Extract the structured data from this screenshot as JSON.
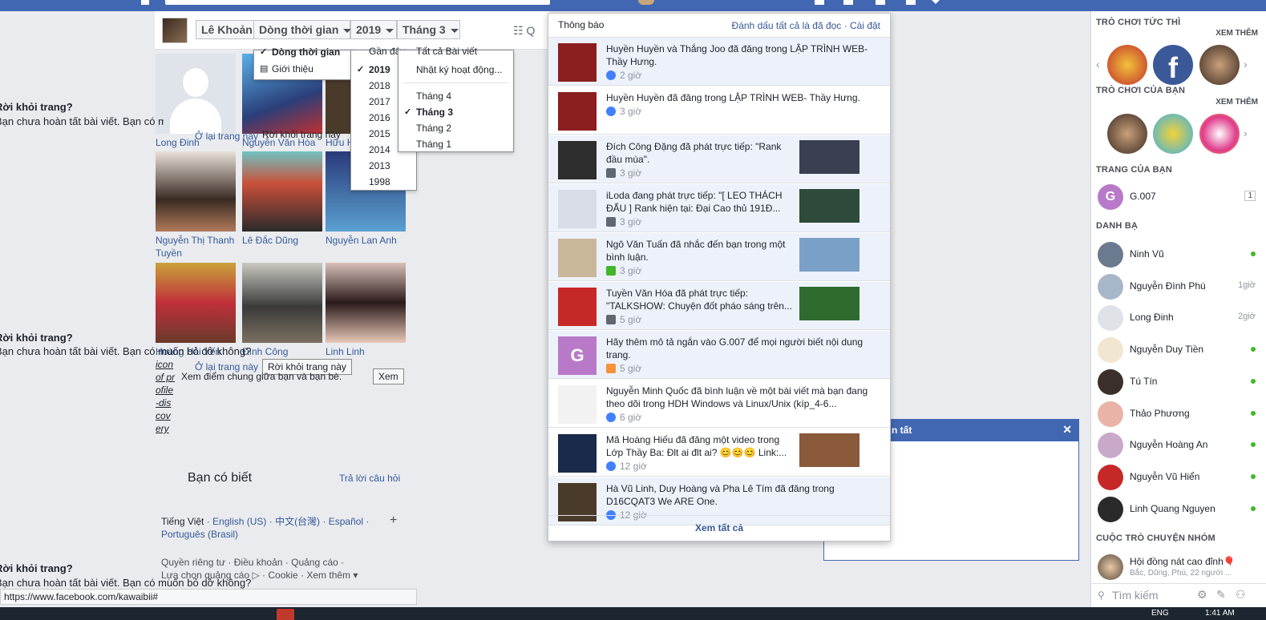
{
  "timeline_bar": {
    "name_button": "Lê Khoản",
    "view_select": "Dòng thời gian",
    "year_select": "2019",
    "month_select": "Tháng 3",
    "settings_label": "Q"
  },
  "view_menu": {
    "items": [
      {
        "label": "Dòng thời gian",
        "checked": true
      },
      {
        "label": "Giới thiệu",
        "checked": false
      }
    ]
  },
  "year_menu": {
    "header": "Gần đây",
    "items": [
      {
        "label": "2019",
        "checked": true
      },
      {
        "label": "2018",
        "checked": false
      },
      {
        "label": "2017",
        "checked": false
      },
      {
        "label": "2016",
        "checked": false
      },
      {
        "label": "2015",
        "checked": false
      },
      {
        "label": "2014",
        "checked": false
      },
      {
        "label": "2013",
        "checked": false
      },
      {
        "label": "1998",
        "checked": false
      }
    ]
  },
  "month_menu": {
    "top_items": [
      "Tất cả Bài viết",
      "Nhật ký hoạt động..."
    ],
    "items": [
      {
        "label": "Tháng 4",
        "checked": false
      },
      {
        "label": "Tháng 3",
        "checked": true
      },
      {
        "label": "Tháng 2",
        "checked": false
      },
      {
        "label": "Tháng 1",
        "checked": false
      }
    ]
  },
  "friends": [
    {
      "name": "Long Đinh"
    },
    {
      "name": "Nguyễn Văn Hòa"
    },
    {
      "name": "Hữu H"
    },
    {
      "name": "Nguyễn Thị Thanh Tuyền"
    },
    {
      "name": "Lê Đắc Dũng"
    },
    {
      "name": "Nguyễn Lan Anh"
    },
    {
      "name": "Hoàng Hải Yến"
    },
    {
      "name": "Đình Công"
    },
    {
      "name": "Linh Linh"
    }
  ],
  "leave_dialogs": {
    "title": "Rời khỏi trang?",
    "body": "Bạn chưa hoàn tất bài viết. Bạn có muốn bỏ dở không?",
    "stay_link": "Ở lại trang này",
    "leave_button": "Rời khỏi trang này"
  },
  "broken_image_alt": "icon of profile-discovery",
  "mutual": {
    "text": "Xem điểm chung giữa bạn và bạn bè.",
    "button": "Xem"
  },
  "know": {
    "title": "Bạn có biết",
    "link": "Trả lời câu hỏi"
  },
  "languages": {
    "current": "Tiếng Việt",
    "others": "English (US) · 中文(台灣) · Español · Português (Brasil)",
    "add": "+"
  },
  "footer_links": {
    "line1": "Quyền riêng tư · Điều khoản · Quảng cáo ·",
    "line2": "Lựa chọn quảng cáo ▷ · Cookie · Xem thêm ▾"
  },
  "status_url": "https://www.facebook.com/kawaibii#",
  "notifications": {
    "title": "Thông báo",
    "mark_all": "Đánh dấu tất cả là đã đọc · Cài đặt",
    "see_all": "Xem tất cả",
    "items": [
      {
        "text": "Huyền Huyền và Thắng Joo đã đăng trong LẬP TRÌNH WEB- Thầy Hưng.",
        "time": "2 giờ",
        "icon": "group-icon",
        "unread": true,
        "avatar_color": "#8b1e1e",
        "thumb": ""
      },
      {
        "text": "Huyền Huyền đã đăng trong LẬP TRÌNH WEB- Thầy Hưng.",
        "time": "3 giờ",
        "icon": "group-icon",
        "unread": false,
        "avatar_color": "#8b1e1e",
        "thumb": ""
      },
      {
        "text": "Đích Công Đặng đã phát trực tiếp: \"Rank đầu mùa\".",
        "time": "3 giờ",
        "icon": "video-icon",
        "unread": true,
        "avatar_color": "#2d2d2d",
        "thumb": "#3a3f52"
      },
      {
        "text": "iLoda đang phát trực tiếp: \"[ LEO THÁCH ĐẤU ] Rank hiện tại: Đại Cao thủ 191Đ...",
        "time": "3 giờ",
        "icon": "video-icon",
        "unread": true,
        "avatar_color": "#d7dce6",
        "thumb": "#2e4a3a"
      },
      {
        "text": "Ngô Văn Tuấn đã nhắc đến bạn trong một bình luận.",
        "time": "3 giờ",
        "icon": "comment-icon",
        "unread": true,
        "avatar_color": "#c9b79a",
        "thumb": "#7aa0c8"
      },
      {
        "text": "Tuyền Văn Hóa đã phát trực tiếp: \"TALKSHOW: Chuyện đốt pháo sáng trên...",
        "time": "5 giờ",
        "icon": "video-icon",
        "unread": true,
        "avatar_color": "#c62828",
        "thumb": "#2f6b2f"
      },
      {
        "text": "Hãy thêm mô tả ngắn vào G.007 để mọi người biết nội dung trang.",
        "time": "5 giờ",
        "icon": "flag-icon",
        "unread": true,
        "avatar_color": "#b87ac8",
        "thumb": ""
      },
      {
        "text": "Nguyễn Minh Quốc đã bình luận về một bài viết mà bạn đang theo dõi trong HDH Windows và Linux/Unix (kíp_4-6...",
        "time": "6 giờ",
        "icon": "group-icon",
        "unread": false,
        "avatar_color": "#f2f2f2",
        "thumb": ""
      },
      {
        "text": "Mã Hoàng Hiếu đã đăng một video trong Lớp Thầy Ba: Đlt ai đlt ai? 😊😊😊 Link:...",
        "time": "12 giờ",
        "icon": "group-icon",
        "unread": false,
        "avatar_color": "#1a2a4a",
        "thumb": "#8a5a3a"
      },
      {
        "text": "Hà Vũ Linh, Duy Hoàng và Pha Lê Tím đã đăng trong D16CQAT3 We ARE One.",
        "time": "12 giờ",
        "icon": "group-icon",
        "unread": true,
        "avatar_color": "#4a3a2a",
        "thumb": ""
      }
    ],
    "avatar_letter": "G"
  },
  "right_column": {
    "instant_games": {
      "title": "TRÒ CHƠI TỨC THÌ",
      "more": "XEM THÊM"
    },
    "your_games": {
      "title": "TRÒ CHƠI CỦA BẠN",
      "more": "XEM THÊM"
    },
    "your_pages": {
      "title": "TRANG CỦA BẠN",
      "page_name": "G.007",
      "page_letter": "G",
      "page_count": "1"
    },
    "contacts_title": "DANH BẠ",
    "contacts": [
      {
        "name": "Ninh Vũ",
        "status": "",
        "online": true,
        "color": "#6b7a8f"
      },
      {
        "name": "Nguyễn Đình Phú",
        "status": "1giờ",
        "online": false,
        "color": "#a7b7c9"
      },
      {
        "name": "Long Đinh",
        "status": "2giờ",
        "online": false,
        "color": "#dfe3e8"
      },
      {
        "name": "Nguyễn Duy Tiền",
        "status": "",
        "online": true,
        "color": "#f1e6d0"
      },
      {
        "name": "Tú Tín",
        "status": "",
        "online": true,
        "color": "#3a2f2a"
      },
      {
        "name": "Thảo Phương",
        "status": "",
        "online": true,
        "color": "#e8b4a8"
      },
      {
        "name": "Nguyễn Hoàng An",
        "status": "",
        "online": true,
        "color": "#c9a9c9"
      },
      {
        "name": "Nguyễn Vũ Hiển",
        "status": "",
        "online": true,
        "color": "#c62828"
      },
      {
        "name": "Linh Quang Nguyen",
        "status": "",
        "online": true,
        "color": "#2a2a2a"
      }
    ],
    "group_chats_title": "CUỘC TRÒ CHUYỆN NHÓM",
    "group_chat": {
      "name": "Hội đồng nát cao đỉnh🎈",
      "members": "Bắc, Dũng, Phú, 22 người ..."
    },
    "search_placeholder": "Tìm kiếm"
  },
  "chat_box": {
    "title": "n tất",
    "close": "✕"
  },
  "taskbar": {
    "lang": "ENG",
    "time": "1:41 AM"
  }
}
